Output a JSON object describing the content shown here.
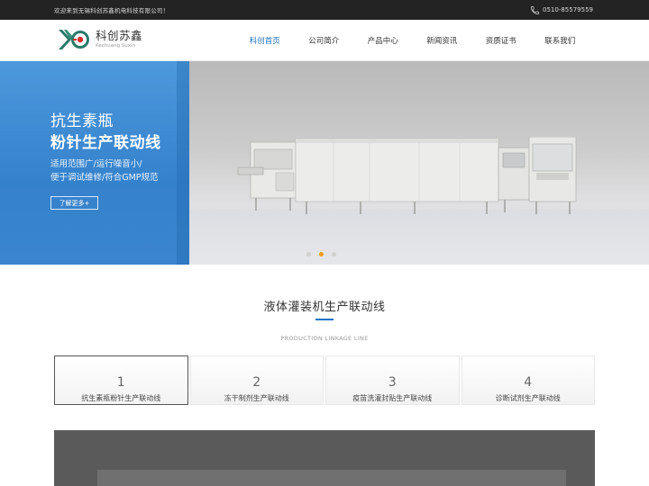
{
  "topbar": {
    "welcome": "欢迎来到无锡科创苏鑫机电科技有限公司！",
    "phone": "0510-85579559",
    "phone_icon": "phone-icon"
  },
  "header": {
    "logo_cn": "科创苏鑫",
    "logo_en": "Kechuang Suxin",
    "nav": [
      "科创首页",
      "公司简介",
      "产品中心",
      "新闻资讯",
      "资质证书",
      "联系我们"
    ],
    "active_nav_index": 0
  },
  "banner": {
    "title_line1": "抗生素瓶",
    "title_line2": "粉针生产联动线",
    "desc_line1": "适用范围广/运行噪音小/",
    "desc_line2": "便于调试维修/符合GMP规范",
    "more_label": "了解更多+",
    "slide_count": 3,
    "active_slide": 2
  },
  "section": {
    "title": "液体灌装机生产联动线",
    "subtitle": "PRODUCTION LINKAGE LINE",
    "cards": [
      {
        "num": "1",
        "label": "抗生素瓶粉针生产联动线"
      },
      {
        "num": "2",
        "label": "冻干制剂生产联动线"
      },
      {
        "num": "3",
        "label": "疫苗洗灌封贴生产联动线"
      },
      {
        "num": "4",
        "label": "诊断试剂生产联动线"
      }
    ],
    "active_card_index": 0
  },
  "colors": {
    "accent": "#1e74c2",
    "banner_blue": "#3a87cf",
    "dot_active": "#f39a1e",
    "topbar": "#232323"
  }
}
